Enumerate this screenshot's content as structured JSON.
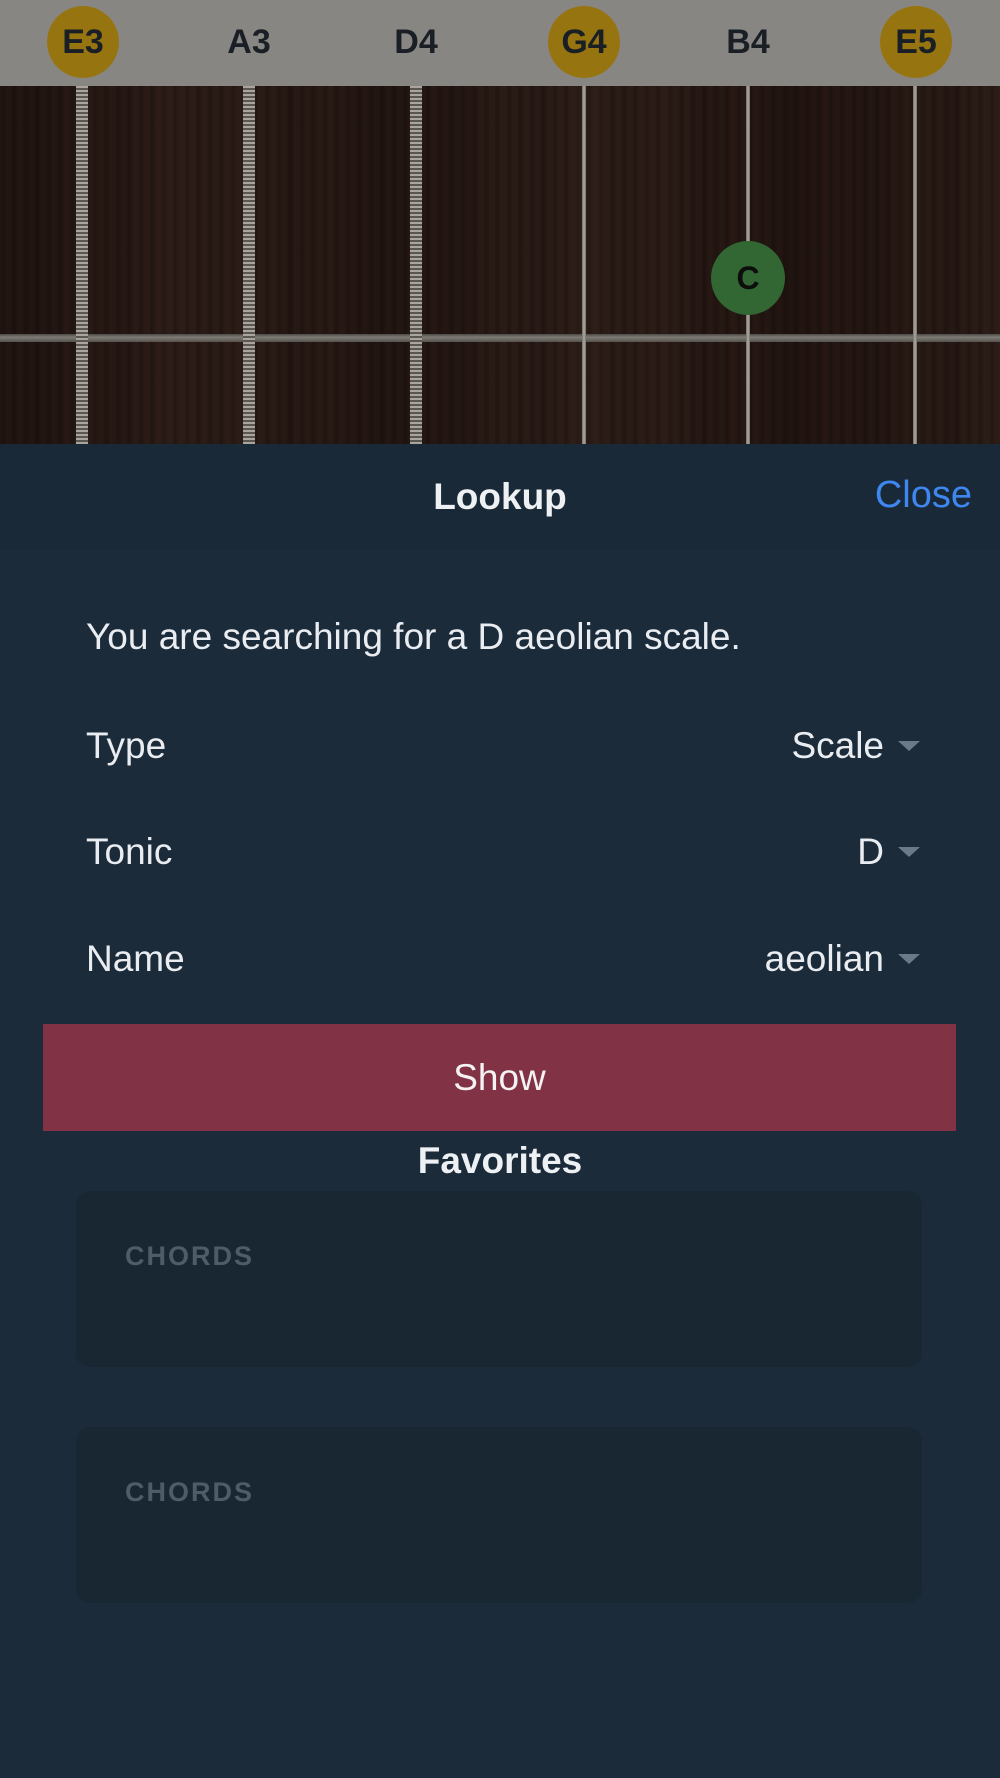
{
  "fretboard": {
    "strings": [
      {
        "label": "E3",
        "highlighted": true,
        "wound": true
      },
      {
        "label": "A3",
        "highlighted": false,
        "wound": true
      },
      {
        "label": "D4",
        "highlighted": false,
        "wound": true
      },
      {
        "label": "G4",
        "highlighted": true,
        "wound": false
      },
      {
        "label": "B4",
        "highlighted": false,
        "wound": false
      },
      {
        "label": "E5",
        "highlighted": true,
        "wound": false
      }
    ],
    "marked_note": {
      "label": "C",
      "string": "B4",
      "color": "#3e7d3f"
    },
    "highlight_color": "#b88f14"
  },
  "lookup": {
    "title": "Lookup",
    "close_label": "Close",
    "description": "You are searching for a D aeolian scale.",
    "fields": {
      "type": {
        "label": "Type",
        "value": "Scale"
      },
      "tonic": {
        "label": "Tonic",
        "value": "D"
      },
      "name": {
        "label": "Name",
        "value": "aeolian"
      }
    },
    "show_label": "Show",
    "show_color": "#823245"
  },
  "favorites": {
    "title": "Favorites",
    "cards": [
      {
        "label": "CHORDS"
      },
      {
        "label": "CHORDS"
      }
    ]
  },
  "colors": {
    "background": "#1c2b3a",
    "accent": "#3e86f0"
  }
}
